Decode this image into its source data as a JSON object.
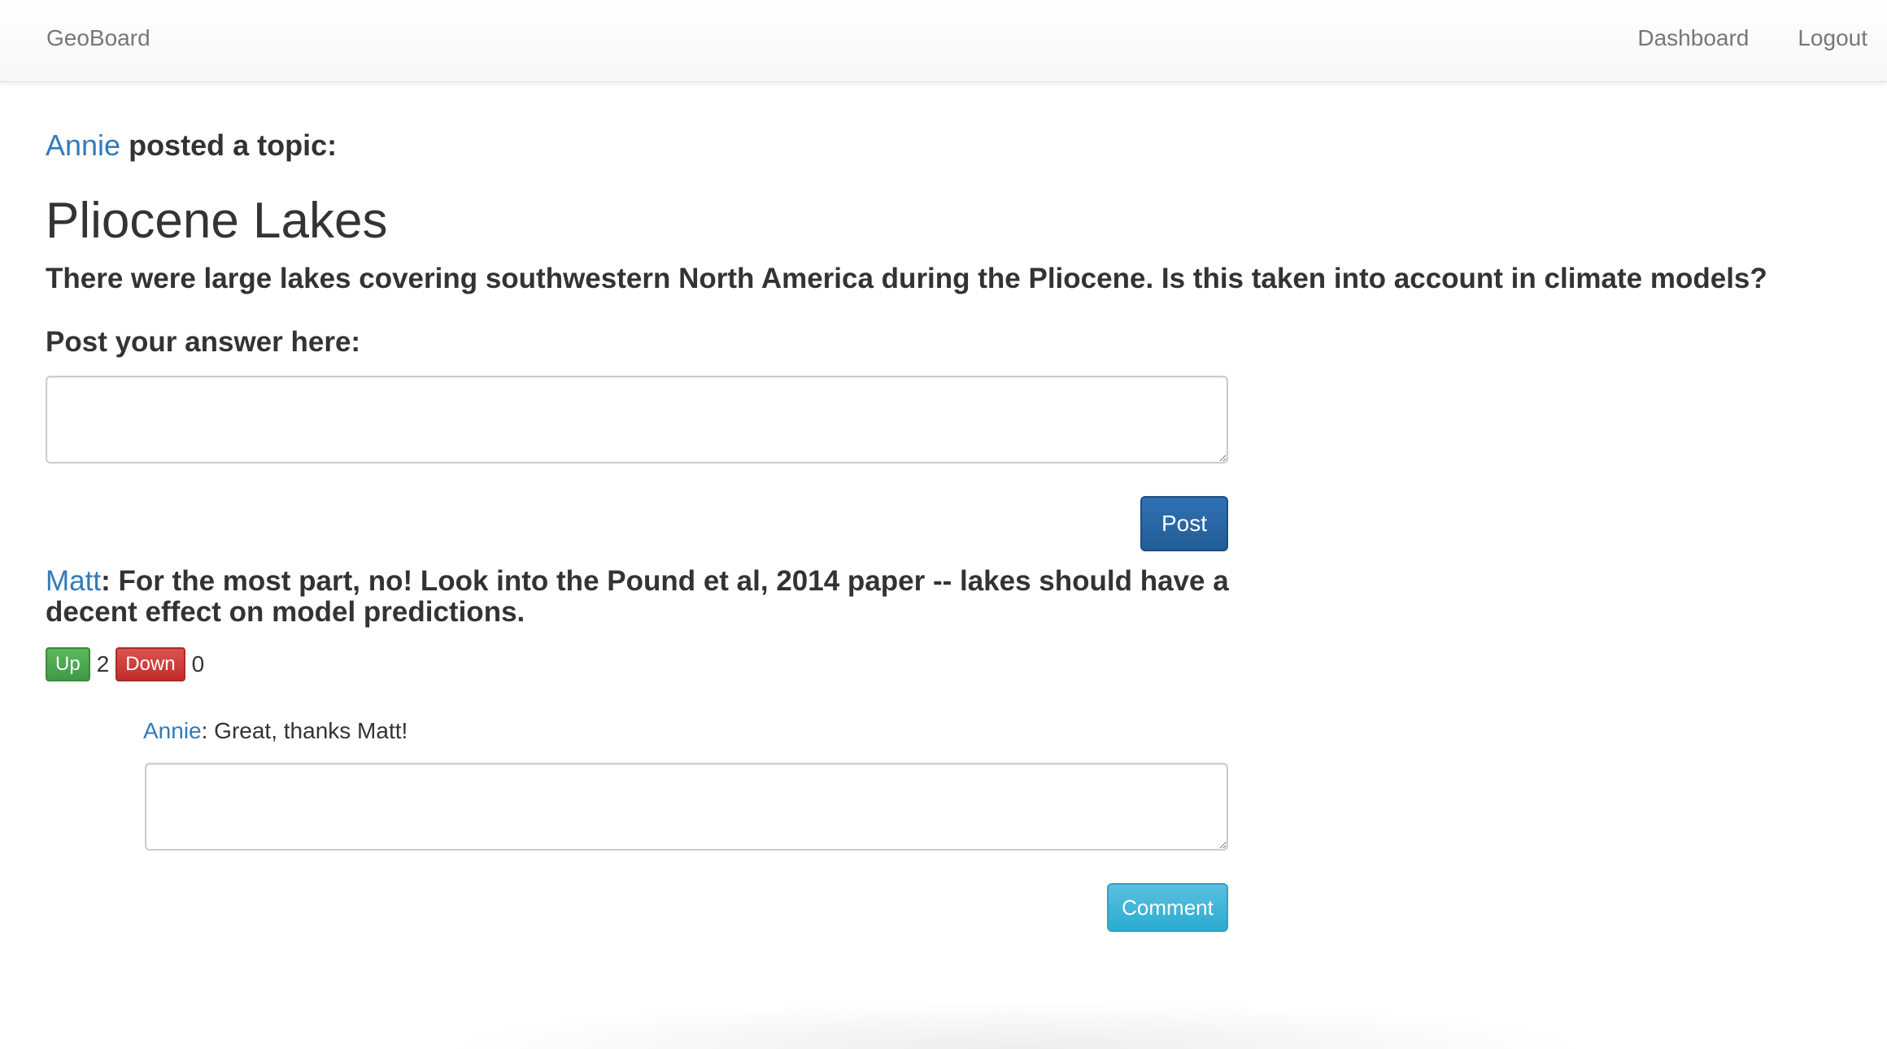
{
  "navbar": {
    "brand": "GeoBoard",
    "links": [
      "Dashboard",
      "Logout"
    ]
  },
  "topic": {
    "author": "Annie",
    "posted_text": " posted a topic:",
    "title": "Pliocene Lakes",
    "body": "There were large lakes covering southwestern North America during the Pliocene. Is this taken into account in climate models?"
  },
  "answer_form": {
    "prompt": "Post your answer here:",
    "value": "",
    "button": "Post"
  },
  "answers": [
    {
      "author": "Matt",
      "separator": ":",
      "text": " For the most part, no! Look into the Pound et al, 2014 paper -- lakes should have a decent effect on model predictions.",
      "up_label": "Up",
      "up_count": "2",
      "down_label": "Down",
      "down_count": "0",
      "comments": [
        {
          "author": "Annie",
          "separator": ":",
          "text": " Great, thanks Matt!"
        }
      ],
      "comment_form": {
        "value": "",
        "button": "Comment"
      }
    }
  ]
}
